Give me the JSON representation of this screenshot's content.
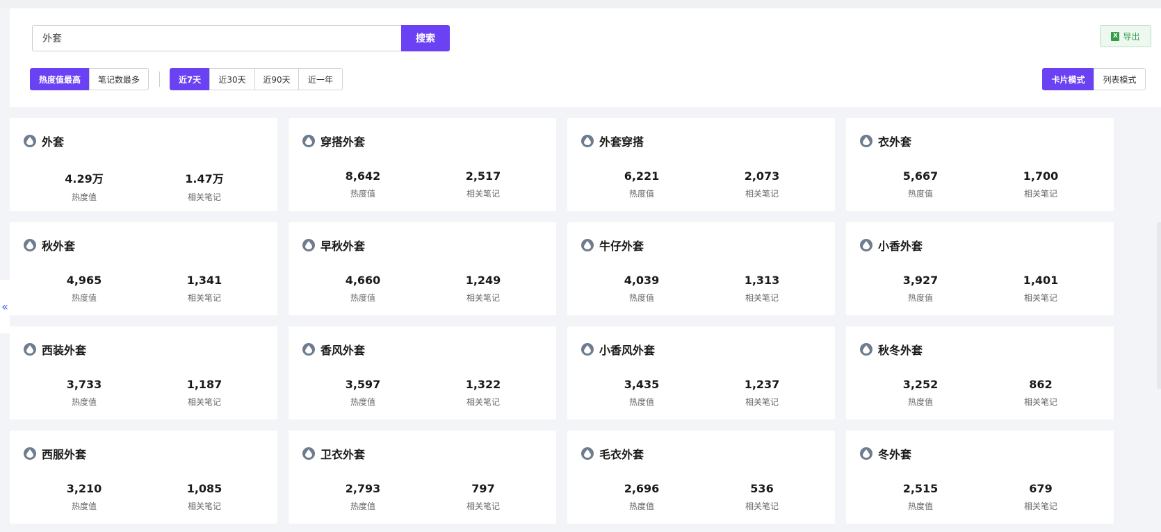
{
  "search": {
    "value": "外套",
    "button_label": "搜索"
  },
  "export": {
    "label": "导出",
    "icon_letter": "X"
  },
  "sort_tabs": [
    {
      "label": "热度值最高",
      "active": true
    },
    {
      "label": "笔记数最多",
      "active": false
    }
  ],
  "range_tabs": [
    {
      "label": "近7天",
      "active": true
    },
    {
      "label": "近30天",
      "active": false
    },
    {
      "label": "近90天",
      "active": false
    },
    {
      "label": "近一年",
      "active": false
    }
  ],
  "view_tabs": [
    {
      "label": "卡片模式",
      "active": true
    },
    {
      "label": "列表模式",
      "active": false
    }
  ],
  "collapse_label": "«",
  "stat_labels": {
    "heat": "热度值",
    "notes": "相关笔记"
  },
  "cards": [
    {
      "title": "外套",
      "heat": "4.29万",
      "notes": "1.47万"
    },
    {
      "title": "穿搭外套",
      "heat": "8,642",
      "notes": "2,517"
    },
    {
      "title": "外套穿搭",
      "heat": "6,221",
      "notes": "2,073"
    },
    {
      "title": "衣外套",
      "heat": "5,667",
      "notes": "1,700"
    },
    {
      "title": "秋外套",
      "heat": "4,965",
      "notes": "1,341"
    },
    {
      "title": "早秋外套",
      "heat": "4,660",
      "notes": "1,249"
    },
    {
      "title": "牛仔外套",
      "heat": "4,039",
      "notes": "1,313"
    },
    {
      "title": "小香外套",
      "heat": "3,927",
      "notes": "1,401"
    },
    {
      "title": "西装外套",
      "heat": "3,733",
      "notes": "1,187"
    },
    {
      "title": "香风外套",
      "heat": "3,597",
      "notes": "1,322"
    },
    {
      "title": "小香风外套",
      "heat": "3,435",
      "notes": "1,237"
    },
    {
      "title": "秋冬外套",
      "heat": "3,252",
      "notes": "862"
    },
    {
      "title": "西服外套",
      "heat": "3,210",
      "notes": "1,085"
    },
    {
      "title": "卫衣外套",
      "heat": "2,793",
      "notes": "797"
    },
    {
      "title": "毛衣外套",
      "heat": "2,696",
      "notes": "536"
    },
    {
      "title": "冬外套",
      "heat": "2,515",
      "notes": "679"
    }
  ],
  "colors": {
    "accent": "#6a42f4",
    "export_green": "#2f9e44",
    "icon_gray": "#6e7c8f"
  }
}
